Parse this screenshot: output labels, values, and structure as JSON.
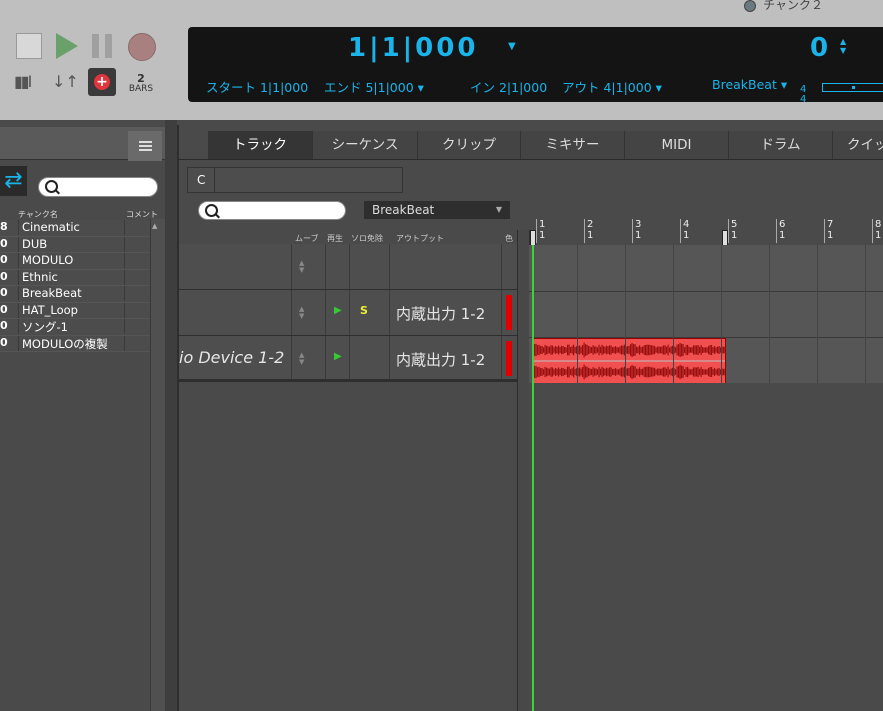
{
  "window": {
    "title": "チャンク２"
  },
  "transport": {
    "stop": "stop",
    "play": "play",
    "pause": "pause",
    "record": "record",
    "add": "+",
    "bars_num": "2",
    "bars_label": "BARS"
  },
  "display": {
    "position": "1|1|000",
    "tempo": "0",
    "start": "スタート  1|1|000",
    "end": "エンド  5|1|000 ▾",
    "in": "イン  2|1|000",
    "out": "アウト  4|1|000 ▾",
    "sequence": "BreakBeat ▾",
    "sig_top": "4",
    "sig_bottom": "4",
    "lcd_color": "#1ab4ea"
  },
  "chunk_panel": {
    "col_name": "チャンク名",
    "col_comment": "コメント",
    "chunks": [
      {
        "num": "8",
        "name": "Cinematic"
      },
      {
        "num": "0",
        "name": " DUB"
      },
      {
        "num": "0",
        "name": " MODULO"
      },
      {
        "num": "0",
        "name": " Ethnic"
      },
      {
        "num": "0",
        "name": " BreakBeat"
      },
      {
        "num": "0",
        "name": "HAT_Loop"
      },
      {
        "num": "0",
        "name": "ソング-1"
      },
      {
        "num": "0",
        "name": " MODULOの複製"
      }
    ]
  },
  "tabs": [
    "トラック",
    "シーケンス",
    "クリップ",
    "ミキサー",
    "MIDI",
    "ドラム",
    "クイッ"
  ],
  "c_field": {
    "label": "C"
  },
  "sequence_select": {
    "value": "BreakBeat"
  },
  "track_head": {
    "mute": "ムーブ",
    "play": "再生",
    "solo": "ソロ免除",
    "output": "アウトプット",
    "color": "色"
  },
  "tracks": [
    {
      "name": "",
      "output": "",
      "solo": "",
      "play": "",
      "color": ""
    },
    {
      "name": "",
      "output": "内蔵出力 1-2",
      "solo": "S",
      "play": "▶",
      "color": "#e00000"
    },
    {
      "name": "io Device 1-2",
      "output": "内蔵出力 1-2",
      "solo": "",
      "play": "▶",
      "color": "#e00000"
    }
  ],
  "ruler": {
    "bars": [
      {
        "bar": "1",
        "beat": "1"
      },
      {
        "bar": "2",
        "beat": "1"
      },
      {
        "bar": "3",
        "beat": "1"
      },
      {
        "bar": "4",
        "beat": "1"
      },
      {
        "bar": "5",
        "beat": "1"
      },
      {
        "bar": "6",
        "beat": "1"
      },
      {
        "bar": "7",
        "beat": "1"
      },
      {
        "bar": "8",
        "beat": "1"
      }
    ]
  }
}
